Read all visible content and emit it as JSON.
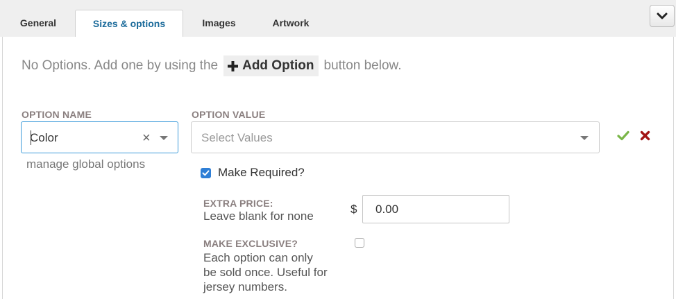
{
  "tabs": [
    {
      "label": "General",
      "active": false
    },
    {
      "label": "Sizes & options",
      "active": true
    },
    {
      "label": "Images",
      "active": false
    },
    {
      "label": "Artwork",
      "active": false
    }
  ],
  "intro": {
    "before": "No Options. Add one by using the",
    "button_label": "Add Option",
    "after": "button below."
  },
  "option_name": {
    "label": "OPTION NAME",
    "value": "Color",
    "manage_link": "manage global options"
  },
  "option_value": {
    "label": "OPTION VALUE",
    "placeholder": "Select Values"
  },
  "make_required": {
    "label": "Make Required?",
    "checked": true
  },
  "extra_price": {
    "title": "EXTRA PRICE:",
    "help": "Leave blank for none",
    "currency": "$",
    "value": "0.00"
  },
  "make_exclusive": {
    "title": "MAKE EXCLUSIVE?",
    "help_lines": [
      "Each option can only",
      "be sold once. Useful for",
      "jersey numbers."
    ],
    "checked": false
  },
  "colors": {
    "accent_blue": "#1a6a9a",
    "focus_border": "#3a9ad9",
    "confirm_green": "#7ab648",
    "delete_red": "#a31515",
    "checkbox_blue": "#2f7fd6"
  },
  "icons": [
    "chevron-down-icon",
    "plus-icon",
    "clear-icon",
    "dropdown-arrow-icon",
    "check-icon",
    "delete-icon"
  ]
}
